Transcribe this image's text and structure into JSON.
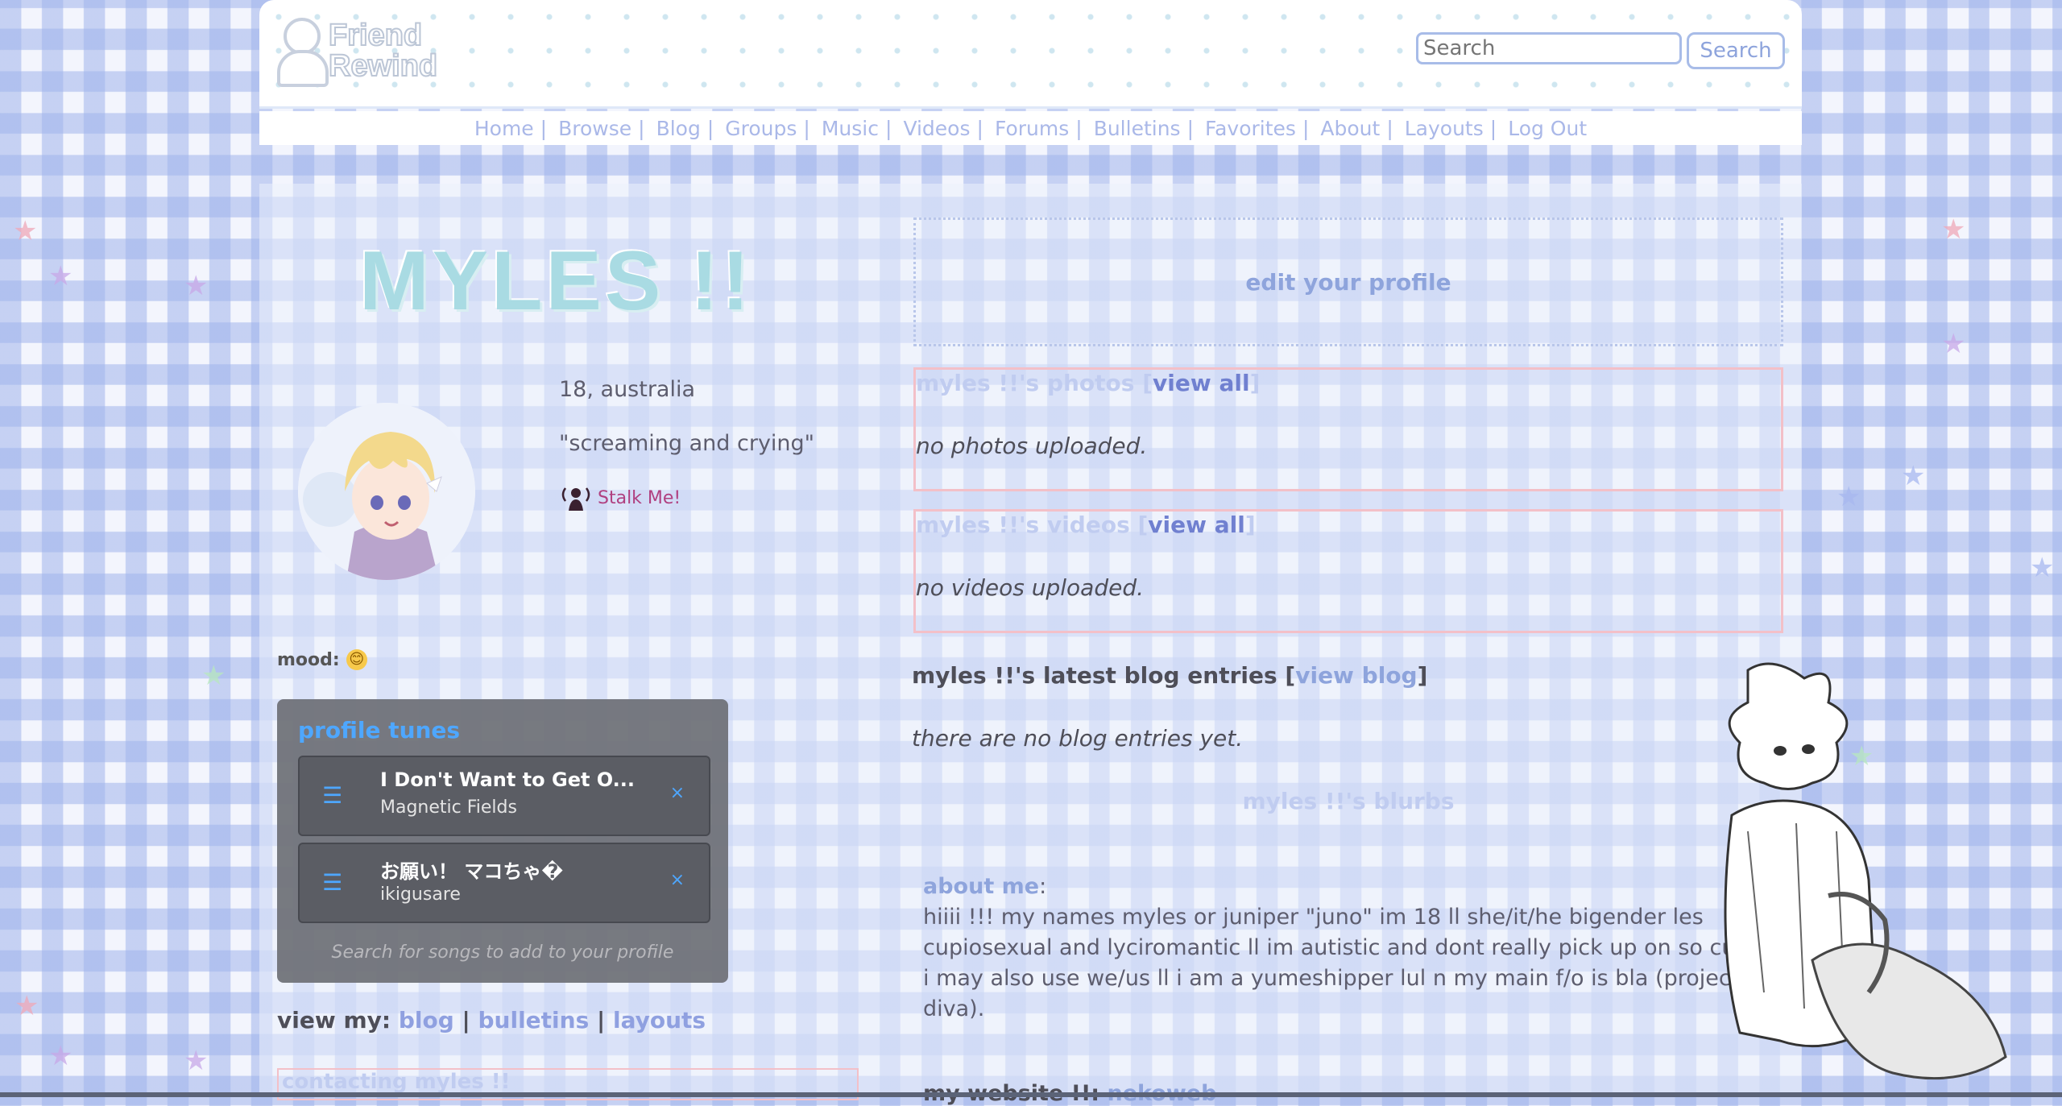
{
  "site": {
    "logo_line1": "Friend",
    "logo_line2": "Rewind"
  },
  "search": {
    "placeholder": "Search",
    "button_label": "Search"
  },
  "nav": {
    "items": [
      "Home",
      "Browse",
      "Blog",
      "Groups",
      "Music",
      "Videos",
      "Forums",
      "Bulletins",
      "Favorites",
      "About",
      "Layouts",
      "Log Out"
    ],
    "separator": "|"
  },
  "profile": {
    "name": "MYLES !!",
    "age_location": "18, australia",
    "headline": "\"screaming and crying\"",
    "stalk_label": "Stalk Me!",
    "mood_label": "mood:",
    "mood_emoji": "😊"
  },
  "tunes": {
    "title": "profile tunes",
    "tracks": [
      {
        "name": "I Don't Want to Get O...",
        "artist": "Magnetic Fields",
        "remove": "×"
      },
      {
        "name": "お願い！ マコちゃ�",
        "artist": "ikigusare",
        "remove": "×"
      }
    ],
    "search_hint": "Search for songs to add to your profile"
  },
  "view_my": {
    "label": "view my:",
    "links": [
      "blog",
      "bulletins",
      "layouts"
    ],
    "sep": "|"
  },
  "contacting": {
    "label": "contacting myles !!"
  },
  "edit_profile": {
    "label": "edit your profile"
  },
  "photos": {
    "title": "myles !!'s photos",
    "view_all": "view all",
    "empty": "no photos uploaded."
  },
  "videos": {
    "title": "myles !!'s videos",
    "view_all": "view all",
    "empty": "no videos uploaded."
  },
  "blog": {
    "title": "myles !!'s latest blog entries",
    "view": "view blog",
    "empty": "there are no blog entries yet."
  },
  "blurbs": {
    "title": "myles !!'s blurbs",
    "about_label": "about me",
    "about_text": "hiiii !!! my names myles or juniper \"juno\" im 18 ll she/it/he bigender les cupiosexual and lyciromantic ll im autistic and dont really pick up on so cues, i may also use we/us ll i am a yumeshipper lul n my main f/o is bla (project diva).",
    "website_label": "my website !!:",
    "website_link": "nekoweb"
  },
  "colors": {
    "accent_blue": "#8ea4dc",
    "tunes_accent": "#4ea7ff",
    "name_teal": "#a9dbe3",
    "box_pink": "#f3c0c8"
  }
}
